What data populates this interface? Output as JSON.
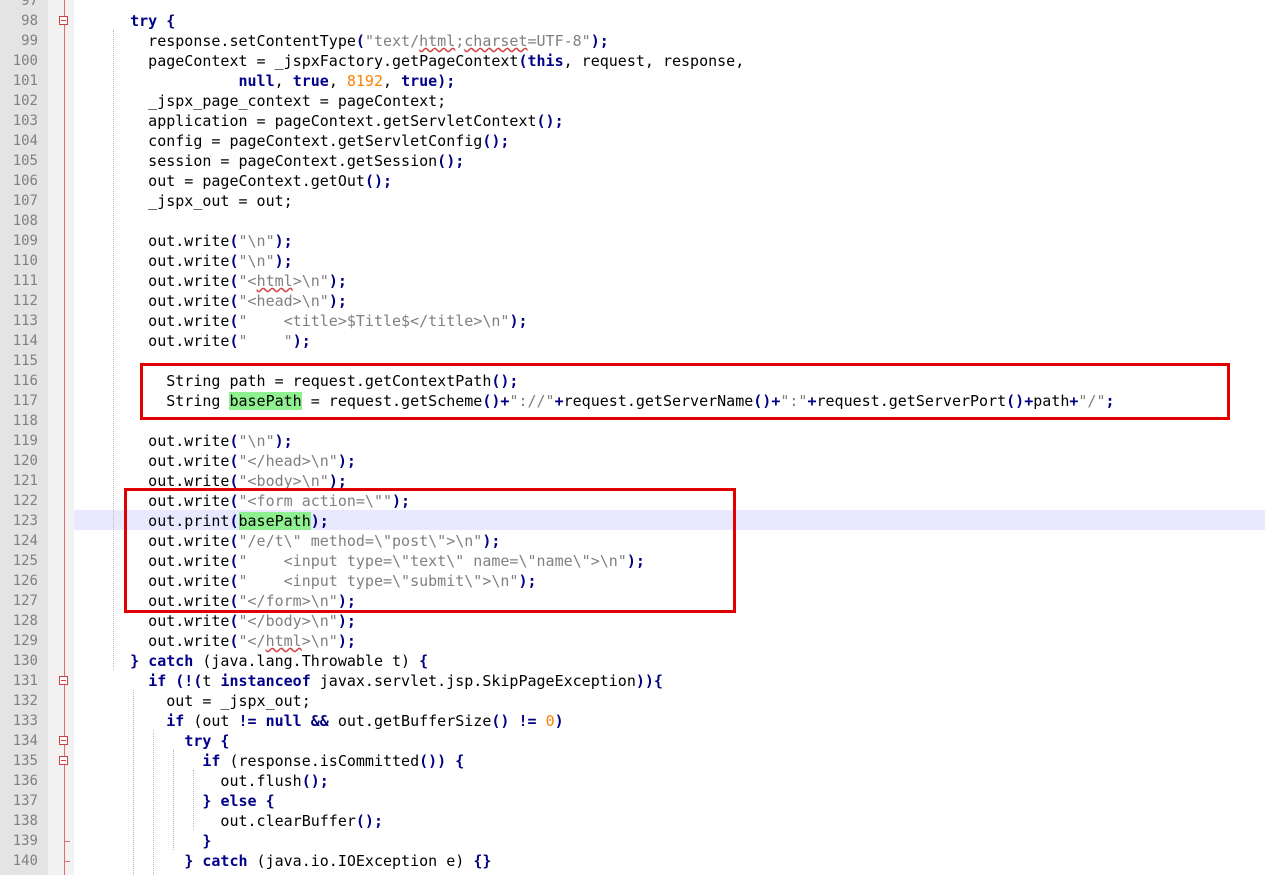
{
  "editor": {
    "highlight_word": "basePath",
    "lines": [
      {
        "n": "97",
        "fold": "",
        "segs": []
      },
      {
        "n": "98",
        "fold": "minus",
        "segs": [
          [
            "    ",
            ""
          ],
          [
            "try",
            "kw"
          ],
          [
            " {",
            "op"
          ]
        ]
      },
      {
        "n": "99",
        "fold": "tick",
        "segs": [
          [
            "      response.setContentType",
            ""
          ],
          [
            "(",
            "op"
          ],
          [
            "\"text/",
            "str"
          ],
          [
            "html",
            "str sq"
          ],
          [
            ";",
            "str"
          ],
          [
            "charset",
            "str sq"
          ],
          [
            "=UTF-8\"",
            "str"
          ],
          [
            ");",
            "op"
          ]
        ]
      },
      {
        "n": "100",
        "fold": "tick",
        "segs": [
          [
            "      pageContext = _jspxFactory.getPageContext",
            ""
          ],
          [
            "(",
            "op"
          ],
          [
            "this",
            "kw"
          ],
          [
            ", request, response,",
            ""
          ]
        ]
      },
      {
        "n": "101",
        "fold": "tick",
        "segs": [
          [
            "                ",
            ""
          ],
          [
            "null",
            "kw"
          ],
          [
            ", ",
            ""
          ],
          [
            "true",
            "kw"
          ],
          [
            ", ",
            ""
          ],
          [
            "8192",
            "num"
          ],
          [
            ", ",
            ""
          ],
          [
            "true",
            "kw"
          ],
          [
            ");",
            "op"
          ]
        ]
      },
      {
        "n": "102",
        "fold": "tick",
        "segs": [
          [
            "      _jspx_page_context = pageContext;",
            ""
          ]
        ]
      },
      {
        "n": "103",
        "fold": "tick",
        "segs": [
          [
            "      application = pageContext.getServletContext",
            ""
          ],
          [
            "();",
            "op"
          ]
        ]
      },
      {
        "n": "104",
        "fold": "tick",
        "segs": [
          [
            "      config = pageContext.getServletConfig",
            ""
          ],
          [
            "();",
            "op"
          ]
        ]
      },
      {
        "n": "105",
        "fold": "tick",
        "segs": [
          [
            "      session = pageContext.getSession",
            ""
          ],
          [
            "();",
            "op"
          ]
        ]
      },
      {
        "n": "106",
        "fold": "tick",
        "segs": [
          [
            "      out = pageContext.getOut",
            ""
          ],
          [
            "();",
            "op"
          ]
        ]
      },
      {
        "n": "107",
        "fold": "tick",
        "segs": [
          [
            "      _jspx_out = out;",
            ""
          ]
        ]
      },
      {
        "n": "108",
        "fold": "tick",
        "segs": []
      },
      {
        "n": "109",
        "fold": "tick",
        "segs": [
          [
            "      out.write",
            ""
          ],
          [
            "(",
            "op"
          ],
          [
            "\"\\n\"",
            "str"
          ],
          [
            ");",
            "op"
          ]
        ]
      },
      {
        "n": "110",
        "fold": "tick",
        "segs": [
          [
            "      out.write",
            ""
          ],
          [
            "(",
            "op"
          ],
          [
            "\"\\n\"",
            "str"
          ],
          [
            ");",
            "op"
          ]
        ]
      },
      {
        "n": "111",
        "fold": "tick",
        "segs": [
          [
            "      out.write",
            ""
          ],
          [
            "(",
            "op"
          ],
          [
            "\"<",
            "str"
          ],
          [
            "html",
            "str sq"
          ],
          [
            ">\\n\"",
            "str"
          ],
          [
            ");",
            "op"
          ]
        ]
      },
      {
        "n": "112",
        "fold": "tick",
        "segs": [
          [
            "      out.write",
            ""
          ],
          [
            "(",
            "op"
          ],
          [
            "\"<head>\\n\"",
            "str"
          ],
          [
            ");",
            "op"
          ]
        ]
      },
      {
        "n": "113",
        "fold": "tick",
        "segs": [
          [
            "      out.write",
            ""
          ],
          [
            "(",
            "op"
          ],
          [
            "\"    <title>$Title$</title>\\n\"",
            "str"
          ],
          [
            ");",
            "op"
          ]
        ]
      },
      {
        "n": "114",
        "fold": "tick",
        "segs": [
          [
            "      out.write",
            ""
          ],
          [
            "(",
            "op"
          ],
          [
            "\"    \"",
            "str"
          ],
          [
            ");",
            "op"
          ]
        ]
      },
      {
        "n": "115",
        "fold": "tick",
        "segs": []
      },
      {
        "n": "116",
        "fold": "tick",
        "segs": [
          [
            "        String path = request.getContextPath",
            ""
          ],
          [
            "();",
            "op"
          ]
        ]
      },
      {
        "n": "117",
        "fold": "tick",
        "segs": [
          [
            "        String ",
            ""
          ],
          [
            "basePath",
            "mark"
          ],
          [
            " = request.getScheme",
            ""
          ],
          [
            "()+",
            "op"
          ],
          [
            "\"://\"",
            "str"
          ],
          [
            "+",
            "op"
          ],
          [
            "request.getServerName",
            ""
          ],
          [
            "()+",
            "op"
          ],
          [
            "\":\"",
            "str"
          ],
          [
            "+",
            "op"
          ],
          [
            "request.getServerPort",
            ""
          ],
          [
            "()+",
            "op"
          ],
          [
            "path",
            ""
          ],
          [
            "+",
            "op"
          ],
          [
            "\"/\"",
            "str"
          ],
          [
            ";",
            "op"
          ]
        ]
      },
      {
        "n": "118",
        "fold": "tick",
        "segs": []
      },
      {
        "n": "119",
        "fold": "tick",
        "segs": [
          [
            "      out.write",
            ""
          ],
          [
            "(",
            "op"
          ],
          [
            "\"\\n\"",
            "str"
          ],
          [
            ");",
            "op"
          ]
        ]
      },
      {
        "n": "120",
        "fold": "tick",
        "segs": [
          [
            "      out.write",
            ""
          ],
          [
            "(",
            "op"
          ],
          [
            "\"</head>\\n\"",
            "str"
          ],
          [
            ");",
            "op"
          ]
        ]
      },
      {
        "n": "121",
        "fold": "tick",
        "segs": [
          [
            "      out.write",
            ""
          ],
          [
            "(",
            "op"
          ],
          [
            "\"<body>\\n\"",
            "str"
          ],
          [
            ");",
            "op"
          ]
        ]
      },
      {
        "n": "122",
        "fold": "tick",
        "segs": [
          [
            "      out.write",
            ""
          ],
          [
            "(",
            "op"
          ],
          [
            "\"<form action=\\\"\"",
            "str"
          ],
          [
            ");",
            "op"
          ]
        ]
      },
      {
        "n": "123",
        "fold": "tick",
        "segs": [
          [
            "      out.print",
            ""
          ],
          [
            "(",
            "op"
          ],
          [
            "basePath",
            "mark"
          ],
          [
            ");",
            "op"
          ]
        ],
        "highlight": true
      },
      {
        "n": "124",
        "fold": "tick",
        "segs": [
          [
            "      out.write",
            ""
          ],
          [
            "(",
            "op"
          ],
          [
            "\"/e/t\\\" method=\\\"post\\\">\\n\"",
            "str"
          ],
          [
            ");",
            "op"
          ]
        ]
      },
      {
        "n": "125",
        "fold": "tick",
        "segs": [
          [
            "      out.write",
            ""
          ],
          [
            "(",
            "op"
          ],
          [
            "\"    <input type=\\\"text\\\" name=\\\"name\\\">\\n\"",
            "str"
          ],
          [
            ");",
            "op"
          ]
        ]
      },
      {
        "n": "126",
        "fold": "tick",
        "segs": [
          [
            "      out.write",
            ""
          ],
          [
            "(",
            "op"
          ],
          [
            "\"    <input type=\\\"submit\\\">\\n\"",
            "str"
          ],
          [
            ");",
            "op"
          ]
        ]
      },
      {
        "n": "127",
        "fold": "tick",
        "segs": [
          [
            "      out.write",
            ""
          ],
          [
            "(",
            "op"
          ],
          [
            "\"</form>\\n\"",
            "str"
          ],
          [
            ");",
            "op"
          ]
        ]
      },
      {
        "n": "128",
        "fold": "tick",
        "segs": [
          [
            "      out.write",
            ""
          ],
          [
            "(",
            "op"
          ],
          [
            "\"</body>\\n\"",
            "str"
          ],
          [
            ");",
            "op"
          ]
        ]
      },
      {
        "n": "129",
        "fold": "tick",
        "segs": [
          [
            "      out.write",
            ""
          ],
          [
            "(",
            "op"
          ],
          [
            "\"</",
            "str"
          ],
          [
            "html",
            "str sq"
          ],
          [
            ">\\n\"",
            "str"
          ],
          [
            ");",
            "op"
          ]
        ]
      },
      {
        "n": "130",
        "fold": "tick",
        "segs": [
          [
            "    ",
            ""
          ],
          [
            "}",
            "op"
          ],
          [
            " ",
            ""
          ],
          [
            "catch",
            "kw"
          ],
          [
            " (java.lang.Throwable t) ",
            ""
          ],
          [
            "{",
            "op"
          ]
        ]
      },
      {
        "n": "131",
        "fold": "minus",
        "segs": [
          [
            "      ",
            ""
          ],
          [
            "if",
            "kw"
          ],
          [
            " ",
            ""
          ],
          [
            "(!(",
            "op"
          ],
          [
            "t ",
            ""
          ],
          [
            "instanceof",
            "kw"
          ],
          [
            " javax.servlet.jsp.SkipPageException",
            ""
          ],
          [
            "))",
            "op"
          ],
          [
            "{",
            "op"
          ]
        ]
      },
      {
        "n": "132",
        "fold": "tick",
        "segs": [
          [
            "        out = _jspx_out;",
            ""
          ]
        ]
      },
      {
        "n": "133",
        "fold": "tick",
        "segs": [
          [
            "        ",
            ""
          ],
          [
            "if",
            "kw"
          ],
          [
            " (out ",
            ""
          ],
          [
            "!=",
            "op"
          ],
          [
            " ",
            ""
          ],
          [
            "null",
            "kw"
          ],
          [
            " ",
            ""
          ],
          [
            "&&",
            "op"
          ],
          [
            " out.getBufferSize",
            ""
          ],
          [
            "()",
            "op"
          ],
          [
            " ",
            ""
          ],
          [
            "!=",
            "op"
          ],
          [
            " ",
            ""
          ],
          [
            "0",
            "num"
          ],
          [
            ")",
            "op"
          ]
        ]
      },
      {
        "n": "134",
        "fold": "minus",
        "segs": [
          [
            "          ",
            ""
          ],
          [
            "try",
            "kw"
          ],
          [
            " {",
            "op"
          ]
        ]
      },
      {
        "n": "135",
        "fold": "minus",
        "segs": [
          [
            "            ",
            ""
          ],
          [
            "if",
            "kw"
          ],
          [
            " (response.isCommitted",
            ""
          ],
          [
            "())",
            "op"
          ],
          [
            " {",
            "op"
          ]
        ]
      },
      {
        "n": "136",
        "fold": "tick",
        "segs": [
          [
            "              out.flush",
            ""
          ],
          [
            "();",
            "op"
          ]
        ]
      },
      {
        "n": "137",
        "fold": "tick",
        "segs": [
          [
            "            ",
            ""
          ],
          [
            "}",
            "op"
          ],
          [
            " ",
            ""
          ],
          [
            "else",
            "kw"
          ],
          [
            " {",
            "op"
          ]
        ]
      },
      {
        "n": "138",
        "fold": "tick",
        "segs": [
          [
            "              out.clearBuffer",
            ""
          ],
          [
            "();",
            "op"
          ]
        ]
      },
      {
        "n": "139",
        "fold": "end",
        "segs": [
          [
            "            ",
            ""
          ],
          [
            "}",
            "op"
          ]
        ]
      },
      {
        "n": "140",
        "fold": "end",
        "segs": [
          [
            "          ",
            ""
          ],
          [
            "}",
            "op"
          ],
          [
            " ",
            ""
          ],
          [
            "catch",
            "kw"
          ],
          [
            " (java.io.IOException e) ",
            ""
          ],
          [
            "{}",
            "op"
          ]
        ]
      }
    ]
  }
}
